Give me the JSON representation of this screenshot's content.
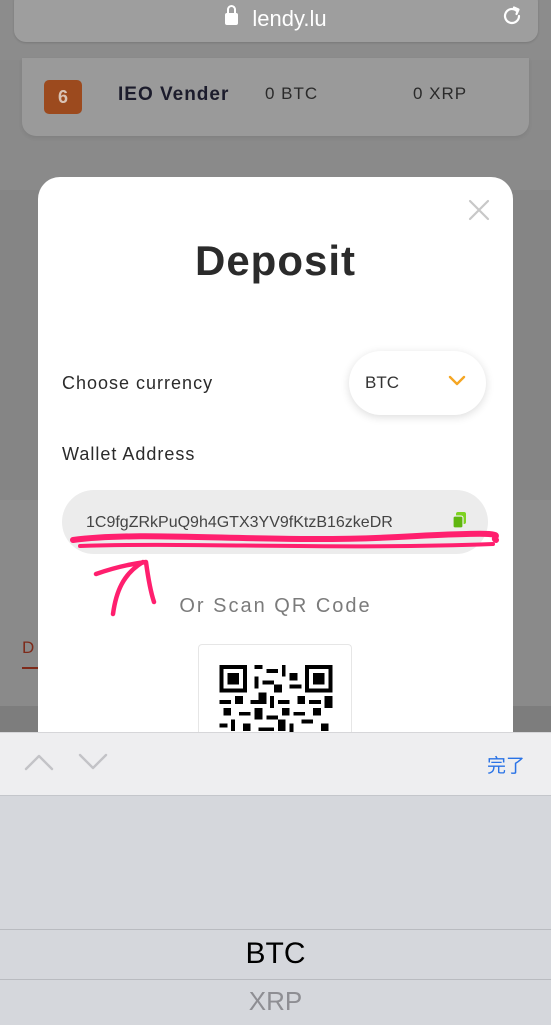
{
  "browser": {
    "url": "lendy.lu"
  },
  "background": {
    "row": {
      "rank": "6",
      "name": "IEO Vender",
      "btc": "0 BTC",
      "xrp": "0 XRP"
    },
    "tab_initial": "D"
  },
  "modal": {
    "title": "Deposit",
    "currency_label": "Choose currency",
    "currency_value": "BTC",
    "wallet_label": "Wallet Address",
    "address": "1C9fgZRkPuQ9h4GTX3YV9fKtzB16zkeDR",
    "scan_label": "Or Scan QR Code"
  },
  "keyboard": {
    "done": "完了"
  },
  "picker": {
    "options": [
      "BTC",
      "XRP"
    ],
    "selected": "BTC"
  },
  "colors": {
    "accent_orange": "#f5a623",
    "annotation_pink": "#ff1f6e",
    "copy_green": "#7ed321",
    "done_blue": "#2a73e6"
  }
}
